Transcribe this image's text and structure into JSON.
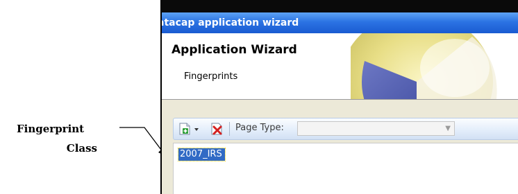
{
  "annotation": {
    "line1": "Fingerprint",
    "line2": "Class"
  },
  "window": {
    "title": "Datacap application wizard",
    "title_visible": "atacap application wizard"
  },
  "header": {
    "title": "Application Wizard",
    "subtitle": "Fingerprints"
  },
  "toolbar": {
    "add_icon": "add-page-icon",
    "delete_icon": "delete-icon",
    "page_type_label": "Page Type:",
    "page_type_value": ""
  },
  "list": {
    "items": [
      "2007_IRS"
    ],
    "selected_index": 0
  },
  "colors": {
    "titlebar": "#2b73e3",
    "selection": "#316ac5",
    "panel": "#ece9d8"
  }
}
